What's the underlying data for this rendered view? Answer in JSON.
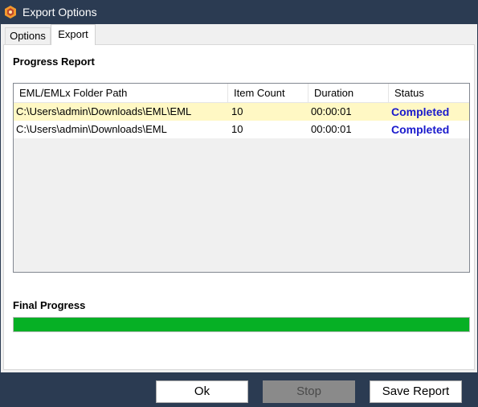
{
  "window": {
    "title": "Export Options",
    "icon": "app-logo-icon"
  },
  "tabs": [
    {
      "label": "Options",
      "selected": false
    },
    {
      "label": "Export",
      "selected": true
    }
  ],
  "progress_report": {
    "title": "Progress Report",
    "columns": [
      "EML/EMLx Folder Path",
      "Item Count",
      "Duration",
      "Status"
    ],
    "rows": [
      {
        "path": "C:\\Users\\admin\\Downloads\\EML\\EML",
        "item_count": "10",
        "duration": "00:00:01",
        "status": "Completed"
      },
      {
        "path": "C:\\Users\\admin\\Downloads\\EML",
        "item_count": "10",
        "duration": "00:00:01",
        "status": "Completed"
      }
    ]
  },
  "final_progress": {
    "title": "Final Progress",
    "value_percent": 100,
    "fill_color": "#06b025"
  },
  "buttons": {
    "ok": "Ok",
    "stop": "Stop",
    "save_report": "Save Report"
  },
  "colors": {
    "title_bar": "#2b3b52",
    "status_completed": "#1a1acc",
    "row_highlight": "#fff8c4"
  }
}
